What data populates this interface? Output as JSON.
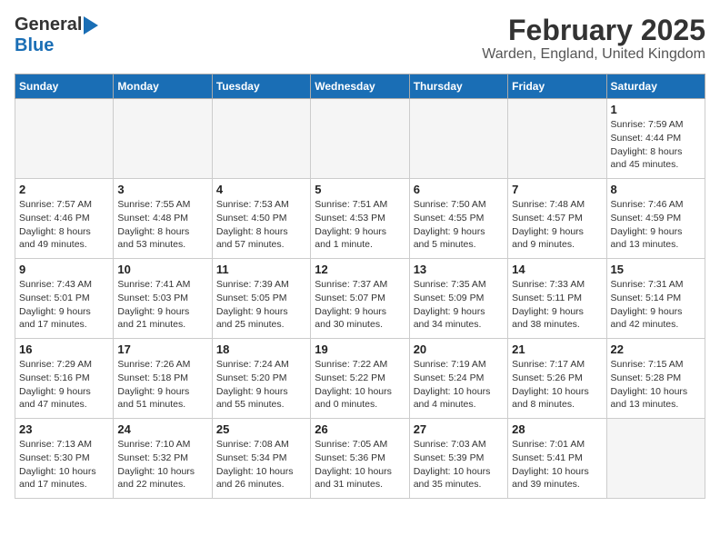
{
  "header": {
    "logo_general": "General",
    "logo_blue": "Blue",
    "title": "February 2025",
    "subtitle": "Warden, England, United Kingdom"
  },
  "weekdays": [
    "Sunday",
    "Monday",
    "Tuesday",
    "Wednesday",
    "Thursday",
    "Friday",
    "Saturday"
  ],
  "weeks": [
    [
      {
        "day": "",
        "info": ""
      },
      {
        "day": "",
        "info": ""
      },
      {
        "day": "",
        "info": ""
      },
      {
        "day": "",
        "info": ""
      },
      {
        "day": "",
        "info": ""
      },
      {
        "day": "",
        "info": ""
      },
      {
        "day": "1",
        "info": "Sunrise: 7:59 AM\nSunset: 4:44 PM\nDaylight: 8 hours\nand 45 minutes."
      }
    ],
    [
      {
        "day": "2",
        "info": "Sunrise: 7:57 AM\nSunset: 4:46 PM\nDaylight: 8 hours\nand 49 minutes."
      },
      {
        "day": "3",
        "info": "Sunrise: 7:55 AM\nSunset: 4:48 PM\nDaylight: 8 hours\nand 53 minutes."
      },
      {
        "day": "4",
        "info": "Sunrise: 7:53 AM\nSunset: 4:50 PM\nDaylight: 8 hours\nand 57 minutes."
      },
      {
        "day": "5",
        "info": "Sunrise: 7:51 AM\nSunset: 4:53 PM\nDaylight: 9 hours\nand 1 minute."
      },
      {
        "day": "6",
        "info": "Sunrise: 7:50 AM\nSunset: 4:55 PM\nDaylight: 9 hours\nand 5 minutes."
      },
      {
        "day": "7",
        "info": "Sunrise: 7:48 AM\nSunset: 4:57 PM\nDaylight: 9 hours\nand 9 minutes."
      },
      {
        "day": "8",
        "info": "Sunrise: 7:46 AM\nSunset: 4:59 PM\nDaylight: 9 hours\nand 13 minutes."
      }
    ],
    [
      {
        "day": "9",
        "info": "Sunrise: 7:43 AM\nSunset: 5:01 PM\nDaylight: 9 hours\nand 17 minutes."
      },
      {
        "day": "10",
        "info": "Sunrise: 7:41 AM\nSunset: 5:03 PM\nDaylight: 9 hours\nand 21 minutes."
      },
      {
        "day": "11",
        "info": "Sunrise: 7:39 AM\nSunset: 5:05 PM\nDaylight: 9 hours\nand 25 minutes."
      },
      {
        "day": "12",
        "info": "Sunrise: 7:37 AM\nSunset: 5:07 PM\nDaylight: 9 hours\nand 30 minutes."
      },
      {
        "day": "13",
        "info": "Sunrise: 7:35 AM\nSunset: 5:09 PM\nDaylight: 9 hours\nand 34 minutes."
      },
      {
        "day": "14",
        "info": "Sunrise: 7:33 AM\nSunset: 5:11 PM\nDaylight: 9 hours\nand 38 minutes."
      },
      {
        "day": "15",
        "info": "Sunrise: 7:31 AM\nSunset: 5:14 PM\nDaylight: 9 hours\nand 42 minutes."
      }
    ],
    [
      {
        "day": "16",
        "info": "Sunrise: 7:29 AM\nSunset: 5:16 PM\nDaylight: 9 hours\nand 47 minutes."
      },
      {
        "day": "17",
        "info": "Sunrise: 7:26 AM\nSunset: 5:18 PM\nDaylight: 9 hours\nand 51 minutes."
      },
      {
        "day": "18",
        "info": "Sunrise: 7:24 AM\nSunset: 5:20 PM\nDaylight: 9 hours\nand 55 minutes."
      },
      {
        "day": "19",
        "info": "Sunrise: 7:22 AM\nSunset: 5:22 PM\nDaylight: 10 hours\nand 0 minutes."
      },
      {
        "day": "20",
        "info": "Sunrise: 7:19 AM\nSunset: 5:24 PM\nDaylight: 10 hours\nand 4 minutes."
      },
      {
        "day": "21",
        "info": "Sunrise: 7:17 AM\nSunset: 5:26 PM\nDaylight: 10 hours\nand 8 minutes."
      },
      {
        "day": "22",
        "info": "Sunrise: 7:15 AM\nSunset: 5:28 PM\nDaylight: 10 hours\nand 13 minutes."
      }
    ],
    [
      {
        "day": "23",
        "info": "Sunrise: 7:13 AM\nSunset: 5:30 PM\nDaylight: 10 hours\nand 17 minutes."
      },
      {
        "day": "24",
        "info": "Sunrise: 7:10 AM\nSunset: 5:32 PM\nDaylight: 10 hours\nand 22 minutes."
      },
      {
        "day": "25",
        "info": "Sunrise: 7:08 AM\nSunset: 5:34 PM\nDaylight: 10 hours\nand 26 minutes."
      },
      {
        "day": "26",
        "info": "Sunrise: 7:05 AM\nSunset: 5:36 PM\nDaylight: 10 hours\nand 31 minutes."
      },
      {
        "day": "27",
        "info": "Sunrise: 7:03 AM\nSunset: 5:39 PM\nDaylight: 10 hours\nand 35 minutes."
      },
      {
        "day": "28",
        "info": "Sunrise: 7:01 AM\nSunset: 5:41 PM\nDaylight: 10 hours\nand 39 minutes."
      },
      {
        "day": "",
        "info": ""
      }
    ]
  ]
}
